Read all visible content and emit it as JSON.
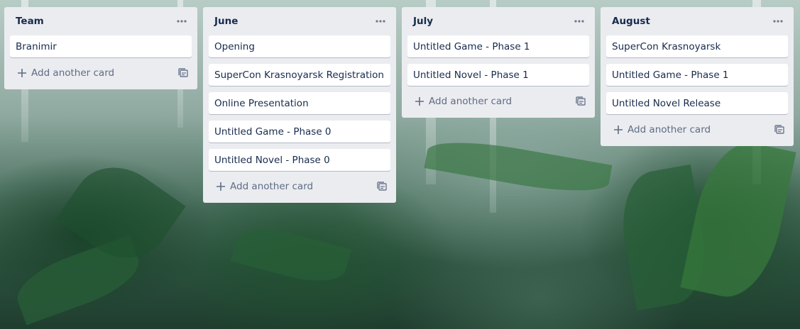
{
  "lists": [
    {
      "title": "Team",
      "cards": [
        "Branimir"
      ],
      "add_label": "Add another card"
    },
    {
      "title": "June",
      "cards": [
        "Opening",
        "SuperCon Krasnoyarsk Registration",
        "Online Presentation",
        "Untitled Game - Phase 0",
        "Untitled Novel - Phase 0"
      ],
      "add_label": "Add another card"
    },
    {
      "title": "July",
      "cards": [
        "Untitled Game - Phase 1",
        "Untitled Novel - Phase 1"
      ],
      "add_label": "Add another card"
    },
    {
      "title": "August",
      "cards": [
        "SuperCon Krasnoyarsk",
        "Untitled Game - Phase 1",
        "Untitled Novel Release"
      ],
      "add_label": "Add another card"
    }
  ],
  "icons": {
    "list_menu": "ellipsis-icon",
    "add": "plus-icon",
    "template": "card-template-icon"
  },
  "colors": {
    "list_bg": "#ebecf0",
    "card_bg": "#ffffff",
    "text": "#172b4d",
    "muted": "#5e6c84"
  }
}
